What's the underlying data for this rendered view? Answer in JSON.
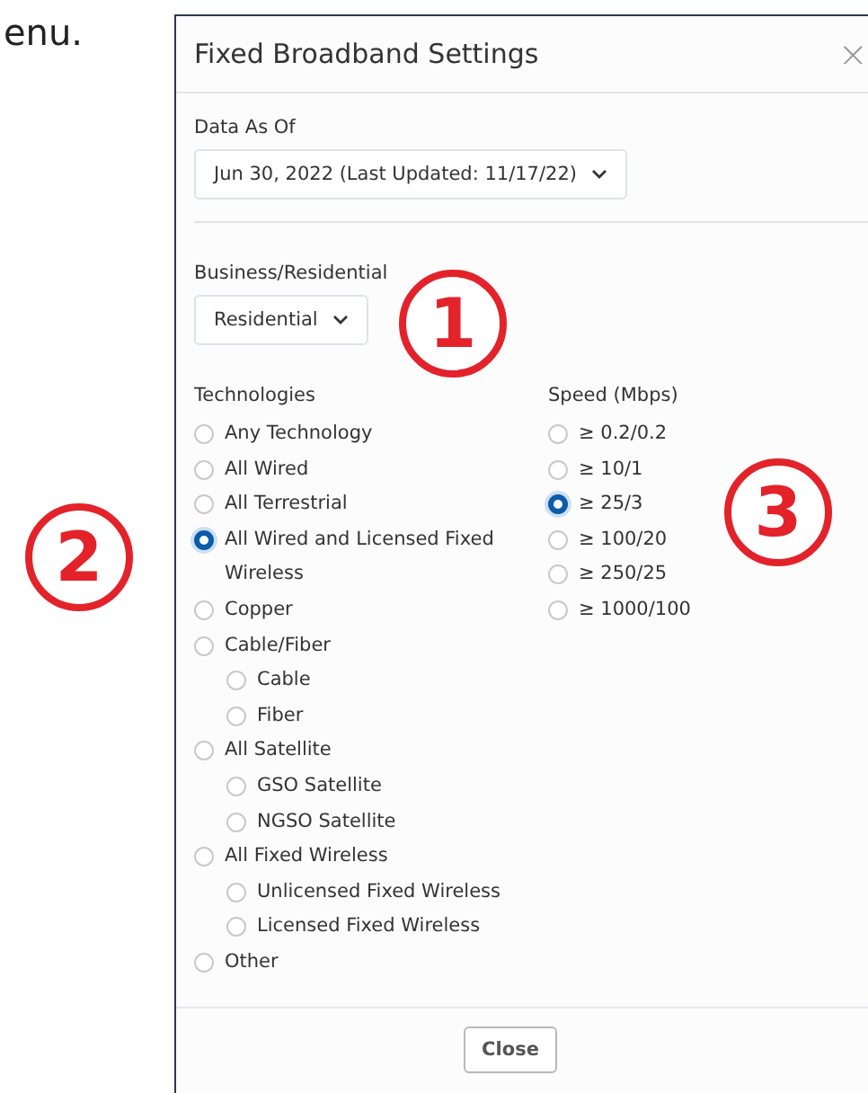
{
  "page_text": "enu.",
  "dialog": {
    "title": "Fixed Broadband Settings",
    "close_icon": "×",
    "data_as_of": {
      "label": "Data As Of",
      "value": "Jun 30, 2022 (Last Updated: 11/17/22)"
    },
    "business_residential": {
      "label": "Business/Residential",
      "value": "Residential"
    },
    "technologies": {
      "label": "Technologies",
      "options": [
        {
          "label": "Any Technology",
          "selected": false
        },
        {
          "label": "All Wired",
          "selected": false
        },
        {
          "label": "All Terrestrial",
          "selected": false
        },
        {
          "label": "All Wired and Licensed Fixed Wireless",
          "selected": true
        },
        {
          "label": "Copper",
          "selected": false
        },
        {
          "label": "Cable/Fiber",
          "selected": false,
          "children": [
            {
              "label": "Cable",
              "selected": false
            },
            {
              "label": "Fiber",
              "selected": false
            }
          ]
        },
        {
          "label": "All Satellite",
          "selected": false,
          "children": [
            {
              "label": "GSO Satellite",
              "selected": false
            },
            {
              "label": "NGSO Satellite",
              "selected": false
            }
          ]
        },
        {
          "label": "All Fixed Wireless",
          "selected": false,
          "children": [
            {
              "label": "Unlicensed Fixed Wireless",
              "selected": false
            },
            {
              "label": "Licensed Fixed Wireless",
              "selected": false
            }
          ]
        },
        {
          "label": "Other",
          "selected": false
        }
      ]
    },
    "speed": {
      "label": "Speed (Mbps)",
      "options": [
        {
          "label": "≥ 0.2/0.2",
          "selected": false
        },
        {
          "label": "≥ 10/1",
          "selected": false
        },
        {
          "label": "≥ 25/3",
          "selected": true
        },
        {
          "label": "≥ 100/20",
          "selected": false
        },
        {
          "label": "≥ 250/25",
          "selected": false
        },
        {
          "label": "≥ 1000/100",
          "selected": false
        }
      ]
    },
    "close_button": "Close"
  },
  "annotations": [
    "1",
    "2",
    "3"
  ]
}
